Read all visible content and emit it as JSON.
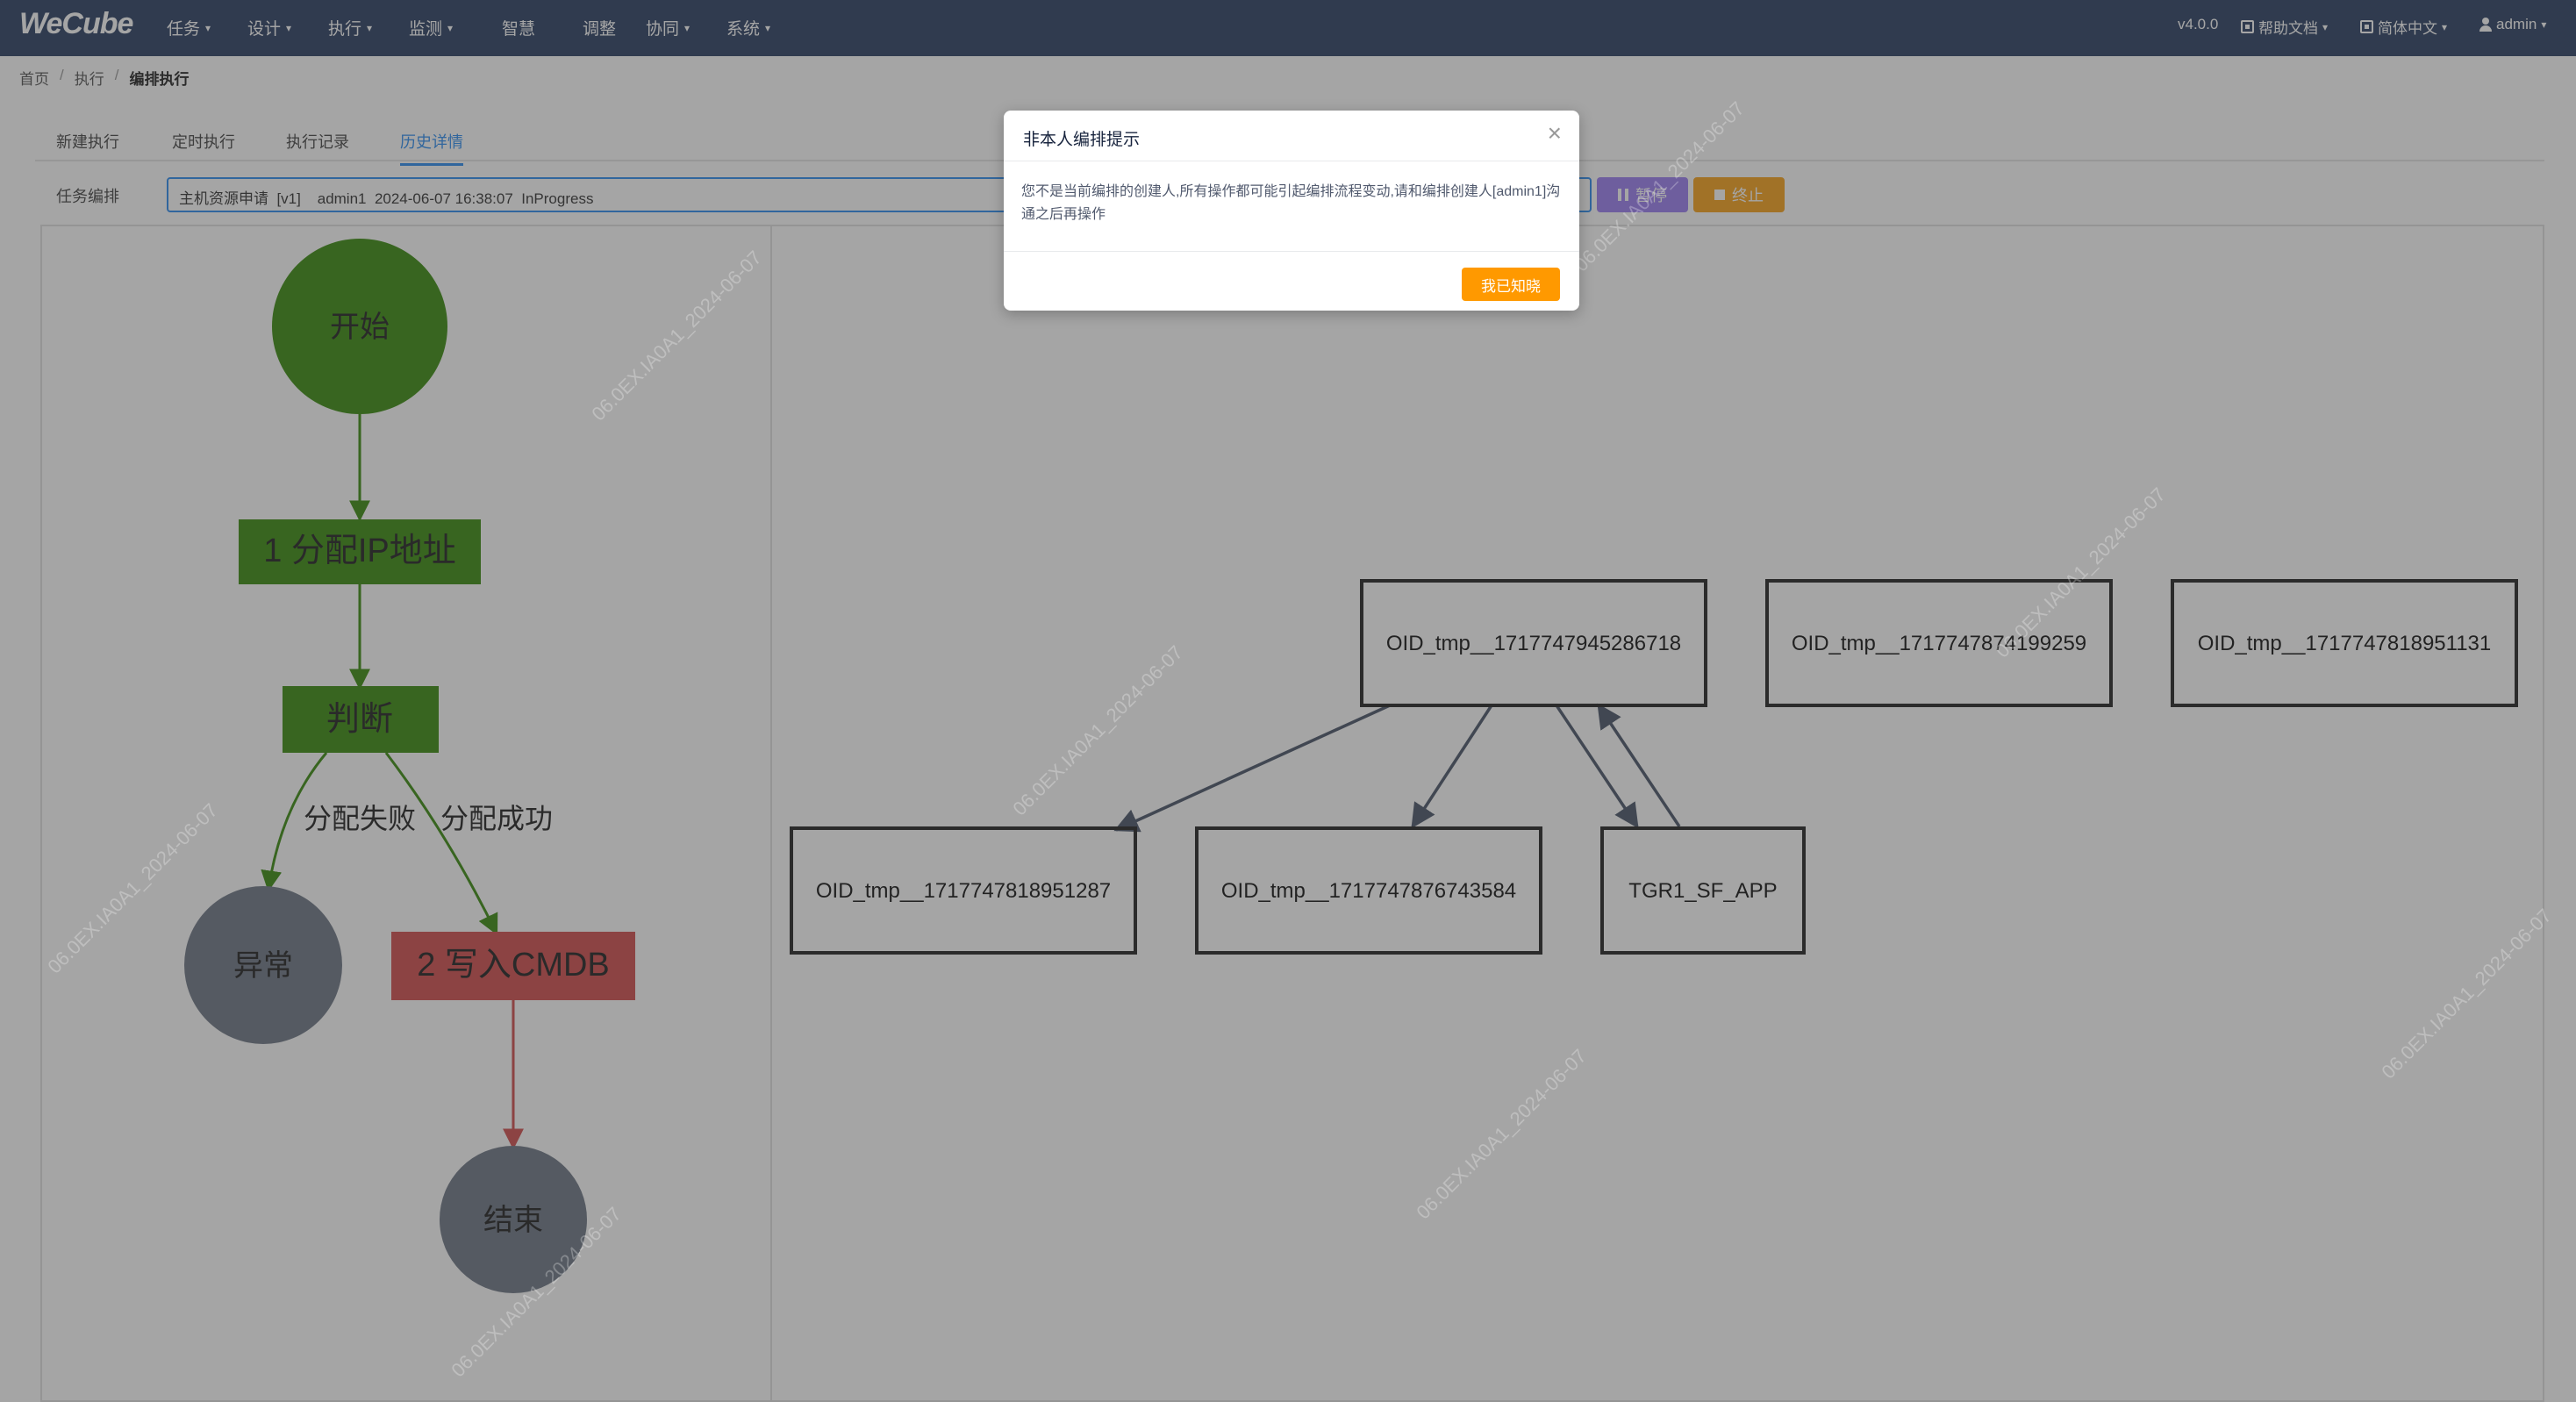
{
  "header": {
    "logo": "WeCube",
    "nav": [
      {
        "label": "任务",
        "caret": true
      },
      {
        "label": "设计",
        "caret": true
      },
      {
        "label": "执行",
        "caret": true
      },
      {
        "label": "监测",
        "caret": true
      },
      {
        "label": "智慧",
        "caret": false
      },
      {
        "label": "调整",
        "caret": false
      },
      {
        "label": "协同",
        "caret": true
      },
      {
        "label": "系统",
        "caret": true
      }
    ],
    "version": "v4.0.0",
    "help": "帮助文档",
    "language": "简体中文",
    "user": "admin"
  },
  "breadcrumb": [
    "首页",
    "执行",
    "编排执行"
  ],
  "tabs": [
    {
      "label": "新建执行",
      "active": false
    },
    {
      "label": "定时执行",
      "active": false
    },
    {
      "label": "执行记录",
      "active": false
    },
    {
      "label": "历史详情",
      "active": true
    }
  ],
  "flow_selector": {
    "label": "任务编排",
    "value": "主机资源申请  [v1]    admin1  2024-06-07 16:38:07  InProgress",
    "pause_label": "暂停",
    "stop_label": "终止"
  },
  "flow_graph": {
    "start": "开始",
    "step1": "1 分配IP地址",
    "decision": "判断",
    "edge_fail": "分配失败",
    "edge_success": "分配成功",
    "exception": "异常",
    "step2": "2 写入CMDB",
    "end": "结束"
  },
  "model_graph": {
    "top_nodes": [
      "OID_tmp__1717747945286718",
      "OID_tmp__1717747874199259",
      "OID_tmp__1717747818951131"
    ],
    "bottom_nodes": [
      "OID_tmp__1717747818951287",
      "OID_tmp__1717747876743584",
      "TGR1_SF_APP"
    ]
  },
  "watermark": "06.0EX.IA0A1_2024-06-07",
  "modal": {
    "title": "非本人编排提示",
    "body": "您不是当前编排的创建人,所有操作都可能引起编排流程变动,请和编排创建人[admin1]沟通之后再操作",
    "confirm": "我已知晓"
  },
  "colors": {
    "nav_bg": "#2b3f63",
    "node_green": "#3a8a0e",
    "node_gray": "#6e7785",
    "node_red": "#d14d4d",
    "accent_blue": "#2d8cf0",
    "pause_purple": "#9c7ef2",
    "stop_orange": "#f7a21b",
    "confirm_orange": "#ff9900"
  }
}
